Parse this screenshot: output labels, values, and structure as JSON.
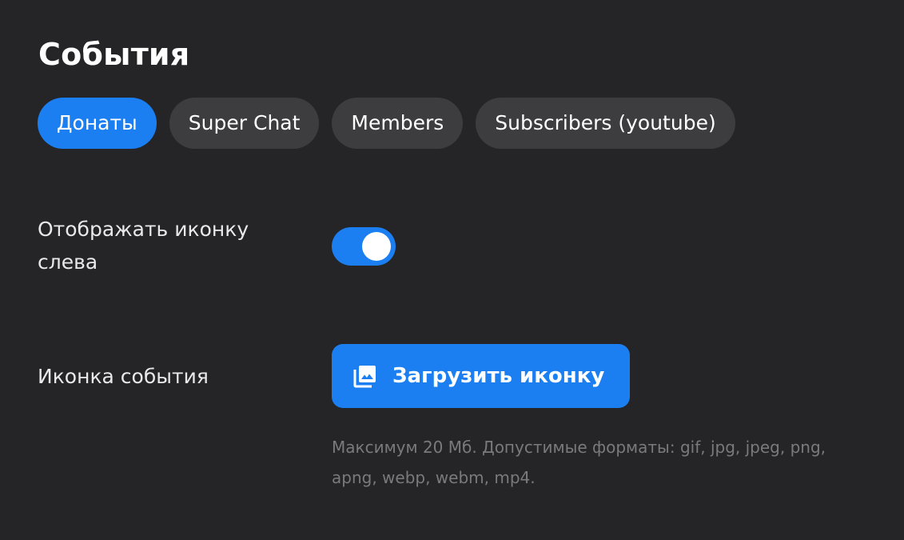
{
  "header": {
    "title": "События"
  },
  "tabs": [
    {
      "label": "Донаты",
      "active": true
    },
    {
      "label": "Super Chat",
      "active": false
    },
    {
      "label": "Members",
      "active": false
    },
    {
      "label": "Subscribers (youtube)",
      "active": false
    }
  ],
  "settings": {
    "show_icon_left": {
      "label": "Отображать иконку слева",
      "enabled": true
    },
    "event_icon": {
      "label": "Иконка события",
      "upload_button_label": "Загрузить иконку",
      "upload_icon": "image-stack-icon",
      "hint": "Максимум 20 Мб. Допустимые форматы: gif, jpg, jpeg, png, apng, webp, webm, mp4."
    }
  },
  "colors": {
    "background": "#252527",
    "accent": "#1b7ff2",
    "tab_inactive": "#3d3d3f",
    "hint_text": "#7a7a7e"
  }
}
